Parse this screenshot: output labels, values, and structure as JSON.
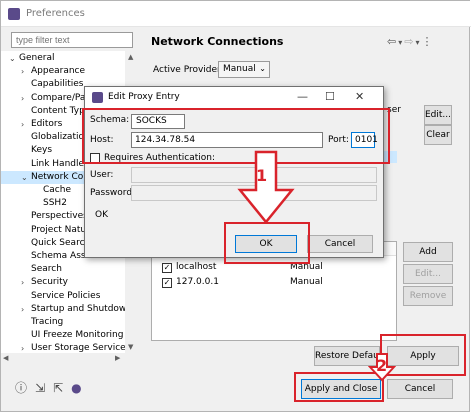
{
  "window": {
    "title": "Preferences"
  },
  "filter": {
    "placeholder": "type filter text"
  },
  "tree": {
    "items": [
      {
        "label": "General",
        "indent": 0,
        "twisty": "expanded"
      },
      {
        "label": "Appearance",
        "indent": 1,
        "twisty": "collapsed"
      },
      {
        "label": "Capabilities",
        "indent": 1,
        "twisty": ""
      },
      {
        "label": "Compare/Pa",
        "indent": 1,
        "twisty": "collapsed"
      },
      {
        "label": "Content Typ",
        "indent": 1,
        "twisty": ""
      },
      {
        "label": "Editors",
        "indent": 1,
        "twisty": "collapsed"
      },
      {
        "label": "Globalizatio",
        "indent": 1,
        "twisty": ""
      },
      {
        "label": "Keys",
        "indent": 1,
        "twisty": ""
      },
      {
        "label": "Link Handle",
        "indent": 1,
        "twisty": ""
      },
      {
        "label": "Network Co",
        "indent": 1,
        "twisty": "expanded",
        "selected": true
      },
      {
        "label": "Cache",
        "indent": 2,
        "twisty": ""
      },
      {
        "label": "SSH2",
        "indent": 2,
        "twisty": ""
      },
      {
        "label": "Perspectives",
        "indent": 1,
        "twisty": ""
      },
      {
        "label": "Project Natu",
        "indent": 1,
        "twisty": ""
      },
      {
        "label": "Quick Searc",
        "indent": 1,
        "twisty": ""
      },
      {
        "label": "Schema Ass",
        "indent": 1,
        "twisty": ""
      },
      {
        "label": "Search",
        "indent": 1,
        "twisty": ""
      },
      {
        "label": "Security",
        "indent": 1,
        "twisty": "collapsed"
      },
      {
        "label": "Service Policies",
        "indent": 1,
        "twisty": ""
      },
      {
        "label": "Startup and Shutdow",
        "indent": 1,
        "twisty": "collapsed"
      },
      {
        "label": "Tracing",
        "indent": 1,
        "twisty": ""
      },
      {
        "label": "UI Freeze Monitoring",
        "indent": 1,
        "twisty": ""
      },
      {
        "label": "User Storage Service",
        "indent": 1,
        "twisty": "collapsed"
      }
    ]
  },
  "page": {
    "title": "Network Connections",
    "active_provider_label": "Active Provider:",
    "active_provider_value": "Manual"
  },
  "proxy_buttons": {
    "edit": "Edit...",
    "clear": "Clear"
  },
  "clipped_header": "ser",
  "bypass": {
    "rows": [
      {
        "checked": true,
        "host": "localhost",
        "provider": "Manual"
      },
      {
        "checked": true,
        "host": "127.0.0.1",
        "provider": "Manual"
      }
    ],
    "add_host": "Add Host...",
    "edit": "Edit...",
    "remove": "Remove"
  },
  "page_buttons": {
    "restore": "Restore Defaults",
    "apply": "Apply"
  },
  "bottom_buttons": {
    "apply_close": "Apply and Close",
    "cancel": "Cancel"
  },
  "dialog": {
    "title": "Edit Proxy Entry",
    "schema_label": "Schema:",
    "schema_value": "SOCKS",
    "host_label": "Host:",
    "host_value": "124.34.78.54",
    "port_label": "Port:",
    "port_value": "0101",
    "requires_auth": "Requires Authentication:",
    "requires_auth_checked": false,
    "user_label": "User:",
    "password_label": "Password:",
    "status": "OK",
    "ok": "OK",
    "cancel": "Cancel"
  },
  "annotations": {
    "step1": "1",
    "step2": "2"
  },
  "colors": {
    "highlight": "#d9232b",
    "selection": "#cce8ff"
  }
}
